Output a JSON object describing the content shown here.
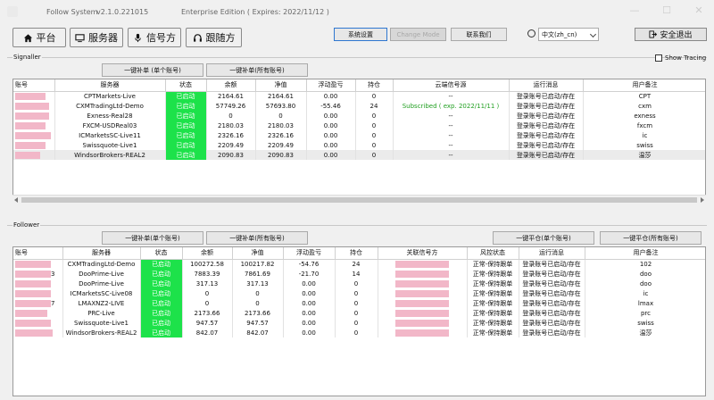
{
  "titlebar": {
    "app_name": "Follow System",
    "version": "v2.1.0.221015",
    "edition": "Enterprise Edition  ( Expires: 2022/11/12 )"
  },
  "nav": {
    "platform": "平台",
    "servers": "服务器",
    "signallers": "信号方",
    "followers": "跟随方"
  },
  "toolbar": {
    "system_settings": "系统设置",
    "change_mode": "Change Mode",
    "contact_us": "联系我们",
    "language": "中文(zh_cn)",
    "logout": "安全退出"
  },
  "signaller": {
    "section_label": "Signaller",
    "show_tracing": "Show Tracing",
    "btn_single": "一键补单 (单个账号)",
    "btn_all": "一键补单(所有账号)",
    "headers": [
      "账号",
      "服务器",
      "状态",
      "余额",
      "净值",
      "浮动盈亏",
      "持仓",
      "云端信号源",
      "运行消息",
      "用户备注"
    ],
    "rows": [
      {
        "server": "CPTMarkets-Live",
        "status": "已启动",
        "balance": "2164.61",
        "equity": "2164.61",
        "pnl": "0.00",
        "pos": "0",
        "cloud": "--",
        "msg": "登录账号已启动/存在",
        "note": "CPT"
      },
      {
        "server": "CXMTradingLtd-Demo",
        "status": "已启动",
        "balance": "57749.26",
        "equity": "57693.80",
        "pnl": "-55.46",
        "pos": "24",
        "cloud": "Subscribed ( exp. 2022/11/11 )",
        "msg": "登录账号已启动/存在",
        "note": "cxm"
      },
      {
        "server": "Exness-Real28",
        "status": "已启动",
        "balance": "0",
        "equity": "0",
        "pnl": "0.00",
        "pos": "0",
        "cloud": "--",
        "msg": "登录账号已启动/存在",
        "note": "exness"
      },
      {
        "server": "FXCM-USDReal03",
        "status": "已启动",
        "balance": "2180.03",
        "equity": "2180.03",
        "pnl": "0.00",
        "pos": "0",
        "cloud": "--",
        "msg": "登录账号已启动/存在",
        "note": "fxcm"
      },
      {
        "server": "ICMarketsSC-Live11",
        "status": "已启动",
        "balance": "2326.16",
        "equity": "2326.16",
        "pnl": "0.00",
        "pos": "0",
        "cloud": "--",
        "msg": "登录账号已启动/存在",
        "note": "ic"
      },
      {
        "server": "Swissquote-Live1",
        "status": "已启动",
        "balance": "2209.49",
        "equity": "2209.49",
        "pnl": "0.00",
        "pos": "0",
        "cloud": "--",
        "msg": "登录账号已启动/存在",
        "note": "swiss"
      },
      {
        "server": "WindsorBrokers-REAL2",
        "status": "已启动",
        "balance": "2090.83",
        "equity": "2090.83",
        "pnl": "0.00",
        "pos": "0",
        "cloud": "--",
        "msg": "登录账号已启动/存在",
        "note": "温莎"
      }
    ]
  },
  "follower": {
    "section_label": "Follower",
    "btn_single": "一键补单(单个账号)",
    "btn_all": "一键补单(所有账号)",
    "btn_close_single": "一键平仓(单个账号)",
    "btn_close_all": "一键平仓(所有账号)",
    "headers": [
      "账号",
      "服务器",
      "状态",
      "余额",
      "净值",
      "浮动盈亏",
      "持仓",
      "关联信号方",
      "风控状态",
      "运行消息",
      "用户备注"
    ],
    "rows": [
      {
        "acct_suffix": "",
        "server": "CXMTradingLtd-Demo",
        "status": "已启动",
        "balance": "100272.58",
        "equity": "100217.82",
        "pnl": "-54.76",
        "pos": "24",
        "risk": "正常-保持跟单",
        "msg": "登录账号已启动/存在",
        "note": "102"
      },
      {
        "acct_suffix": "3",
        "server": "DooPrime-Live",
        "status": "已启动",
        "balance": "7883.39",
        "equity": "7861.69",
        "pnl": "-21.70",
        "pos": "14",
        "risk": "正常-保持跟单",
        "msg": "登录账号已启动/存在",
        "note": "doo"
      },
      {
        "acct_suffix": "",
        "server": "DooPrime-Live",
        "status": "已启动",
        "balance": "317.13",
        "equity": "317.13",
        "pnl": "0.00",
        "pos": "0",
        "risk": "正常-保持跟单",
        "msg": "登录账号已启动/存在",
        "note": "doo"
      },
      {
        "acct_suffix": "",
        "server": "ICMarketsSC-Live08",
        "status": "已启动",
        "balance": "0",
        "equity": "0",
        "pnl": "0.00",
        "pos": "0",
        "risk": "正常-保持跟单",
        "msg": "登录账号已启动/存在",
        "note": "ic"
      },
      {
        "acct_suffix": "7",
        "server": "LMAXNZ2-LIVE",
        "status": "已启动",
        "balance": "0",
        "equity": "0",
        "pnl": "0.00",
        "pos": "0",
        "risk": "正常-保持跟单",
        "msg": "登录账号已启动/存在",
        "note": "lmax"
      },
      {
        "acct_suffix": "",
        "server": "PRC-Live",
        "status": "已启动",
        "balance": "2173.66",
        "equity": "2173.66",
        "pnl": "0.00",
        "pos": "0",
        "risk": "正常-保持跟单",
        "msg": "登录账号已启动/存在",
        "note": "prc"
      },
      {
        "acct_suffix": "",
        "server": "Swissquote-Live1",
        "status": "已启动",
        "balance": "947.57",
        "equity": "947.57",
        "pnl": "0.00",
        "pos": "0",
        "risk": "正常-保持跟单",
        "msg": "登录账号已启动/存在",
        "note": "swiss"
      },
      {
        "acct_suffix": "",
        "server": "WindsorBrokers-REAL2",
        "status": "已启动",
        "balance": "842.07",
        "equity": "842.07",
        "pnl": "0.00",
        "pos": "0",
        "risk": "正常-保持跟单",
        "msg": "登录账号已启动/存在",
        "note": "温莎"
      }
    ]
  },
  "colors": {
    "status_green": "#1de24a",
    "subscribed_text": "#22a022",
    "redaction": "#f2b7c8",
    "selected_border": "#2f77d0"
  }
}
